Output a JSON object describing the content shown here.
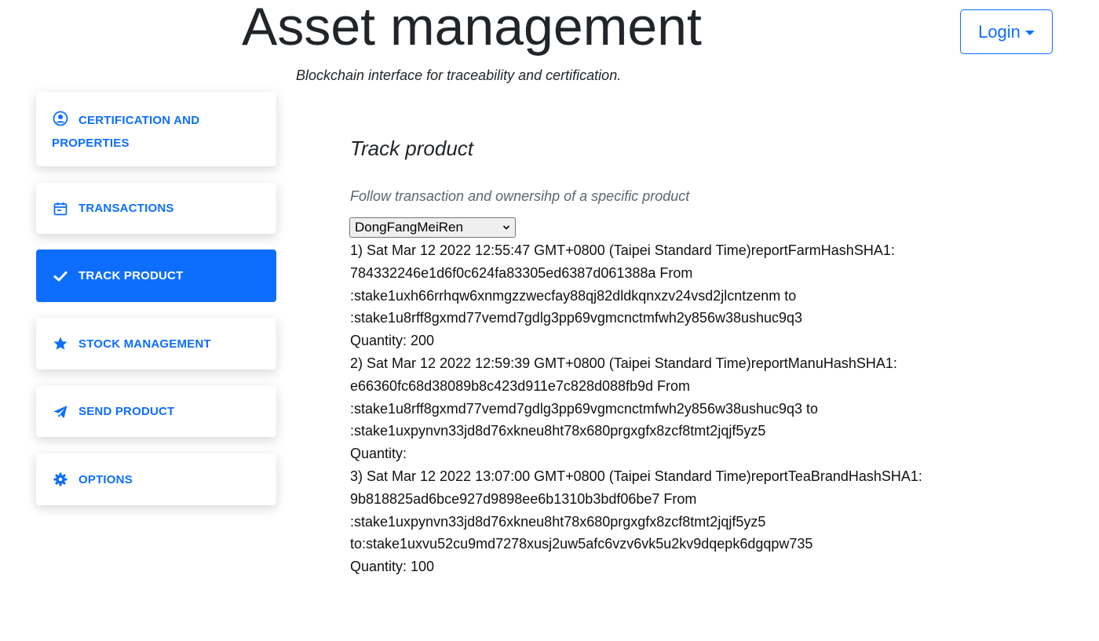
{
  "header": {
    "title": "Asset management",
    "subtitle": "Blockchain interface for traceability and certification."
  },
  "login": {
    "label": "Login"
  },
  "sidebar": {
    "items": [
      {
        "label_line1": "CERTIFICATION AND",
        "label_line2": "PROPERTIES",
        "icon": "user-circle-icon",
        "active": false
      },
      {
        "label": "TRANSACTIONS",
        "icon": "calendar-icon",
        "active": false
      },
      {
        "label": "TRACK PRODUCT",
        "icon": "check-icon",
        "active": true
      },
      {
        "label": "STOCK MANAGEMENT",
        "icon": "star-icon",
        "active": false
      },
      {
        "label": "SEND PRODUCT",
        "icon": "paper-plane-icon",
        "active": false
      },
      {
        "label": "OPTIONS",
        "icon": "gear-icon",
        "active": false
      }
    ]
  },
  "main": {
    "title": "Track product",
    "description": "Follow transaction and ownersihp of a specific product",
    "select": {
      "value": "DongFangMeiRen"
    },
    "transactions": [
      {
        "line1": "1) Sat Mar 12 2022 12:55:47 GMT+0800 (Taipei Standard Time)reportFarmHashSHA1:",
        "line2": "784332246e1d6f0c624fa83305ed6387d061388a From",
        "line3": ":stake1uxh66rrhqw6xnmgzzwecfay88qj82dldkqnxzv24vsd2jlcntzenm to",
        "line4": ":stake1u8rff8gxmd77vemd7gdlg3pp69vgmcnctmfwh2y856w38ushuc9q3",
        "quantity": "Quantity: 200"
      },
      {
        "line1": "2) Sat Mar 12 2022 12:59:39 GMT+0800 (Taipei Standard Time)reportManuHashSHA1:",
        "line2": "e66360fc68d38089b8c423d911e7c828d088fb9d From",
        "line3": ":stake1u8rff8gxmd77vemd7gdlg3pp69vgmcnctmfwh2y856w38ushuc9q3 to",
        "line4": ":stake1uxpynvn33jd8d76xkneu8ht78x680prgxgfx8zcf8tmt2jqjf5yz5",
        "quantity": "Quantity:"
      },
      {
        "line1": "3) Sat Mar 12 2022 13:07:00 GMT+0800 (Taipei Standard Time)reportTeaBrandHashSHA1:",
        "line2": "9b818825ad6bce927d9898ee6b1310b3bdf06be7 From",
        "line3": ":stake1uxpynvn33jd8d76xkneu8ht78x680prgxgfx8zcf8tmt2jqjf5yz5",
        "line4": "to:stake1uxvu52cu9md7278xusj2uw5afc6vzv6vk5u2kv9dqepk6dgqpw735",
        "quantity": "Quantity: 100"
      }
    ]
  },
  "colors": {
    "accent": "#0d6efd",
    "text": "#212529",
    "muted": "#5c6670"
  }
}
